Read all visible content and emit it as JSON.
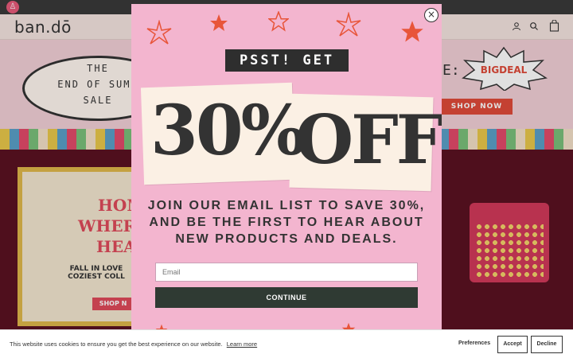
{
  "site": {
    "logo": "ban.dō",
    "accessibility_icon": "accessibility-icon"
  },
  "header": {
    "icons": [
      "account-icon",
      "search-icon",
      "cart-icon"
    ]
  },
  "hero": {
    "oval_lines": [
      "THE",
      "END OF SUMM",
      "SALE"
    ],
    "code_prefix": "E:",
    "burst_text": "BIGDEAL",
    "shop_now": "SHOP NOW"
  },
  "lower_banner": {
    "lines": [
      "HOM",
      "WHERR",
      "HEAR"
    ],
    "sub": "FALL IN LOVE COZIEST COLL",
    "shop": "SHOP N"
  },
  "modal": {
    "kicker": "PSST! GET",
    "big_left": "30%",
    "big_right": "OFF",
    "message": "JOIN OUR EMAIL LIST TO SAVE 30%, AND BE THE FIRST TO HEAR ABOUT NEW PRODUCTS AND DEALS.",
    "email_placeholder": "Email",
    "continue_label": "CONTINUE",
    "close_label": "×",
    "accent_color": "#f3b5cf",
    "star_color": "#e8553a"
  },
  "cookie": {
    "text": "This website uses cookies to ensure you get the best experience on our website.",
    "link": "Learn more",
    "preferences": "Preferences",
    "accept": "Accept",
    "decline": "Decline"
  }
}
